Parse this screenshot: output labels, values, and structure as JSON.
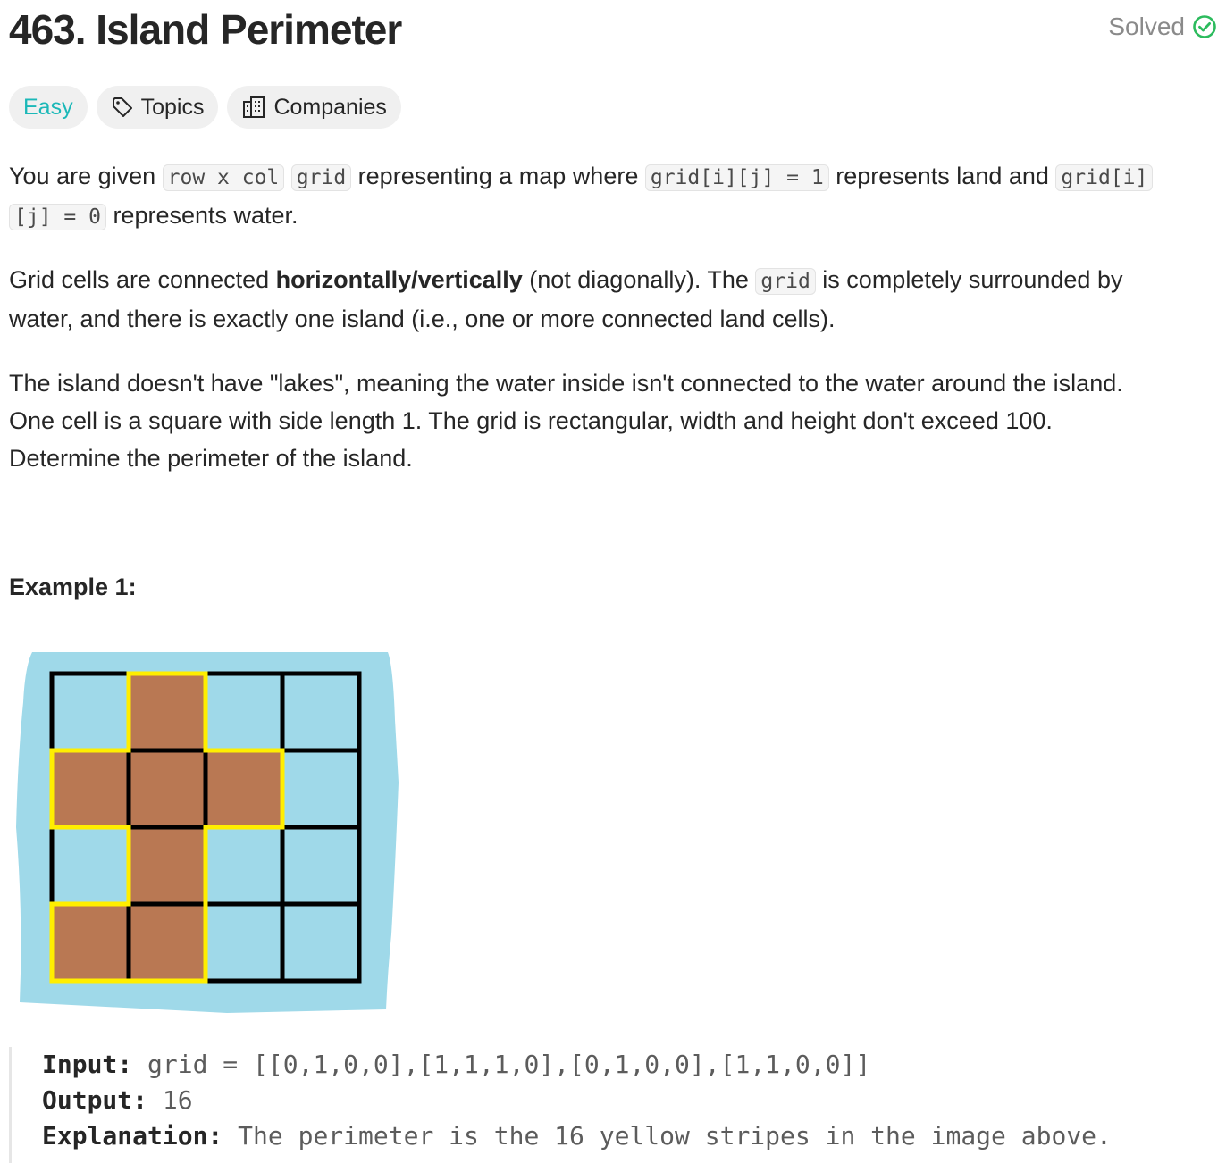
{
  "problem": {
    "title": "463. Island Perimeter",
    "status": "Solved"
  },
  "tags": {
    "difficulty": "Easy",
    "topics": "Topics",
    "companies": "Companies"
  },
  "description": {
    "p1": {
      "t1": "You are given ",
      "c1": "row x col",
      "t2": " ",
      "c2": "grid",
      "t3": " representing a map where ",
      "c3": "grid[i][j] = 1",
      "t4": " represents land and ",
      "c4a": "grid[i]",
      "c4b": "[j] = 0",
      "t5": " represents water."
    },
    "p2": {
      "t1": "Grid cells are connected ",
      "b1": "horizontally/vertically",
      "t2": " (not diagonally). The ",
      "c1": "grid",
      "t3": " is completely surrounded by",
      "t4": "water, and there is exactly one island (i.e., one or more connected land cells)."
    },
    "p3": {
      "l1": "The island doesn't have \"lakes\", meaning the water inside isn't connected to the water around the island.",
      "l2": "One cell is a square with side length 1. The grid is rectangular, width and height don't exceed 100.",
      "l3": "Determine the perimeter of the island."
    }
  },
  "example1": {
    "title": "Example 1:",
    "grid": [
      [
        0,
        1,
        0,
        0
      ],
      [
        1,
        1,
        1,
        0
      ],
      [
        0,
        1,
        0,
        0
      ],
      [
        1,
        1,
        0,
        0
      ]
    ],
    "colors": {
      "water": "#9fd9e9",
      "land": "#b97853",
      "perimeter": "#ffee00",
      "gridline": "#000000"
    },
    "input_label": "Input:",
    "input_value": "grid = [[0,1,0,0],[1,1,1,0],[0,1,0,0],[1,1,0,0]]",
    "output_label": "Output:",
    "output_value": "16",
    "explanation_label": "Explanation:",
    "explanation_value": "The perimeter is the 16 yellow stripes in the image above."
  },
  "icons": {
    "solved": "check-circle-icon",
    "topics": "tag-icon",
    "companies": "building-icon"
  }
}
